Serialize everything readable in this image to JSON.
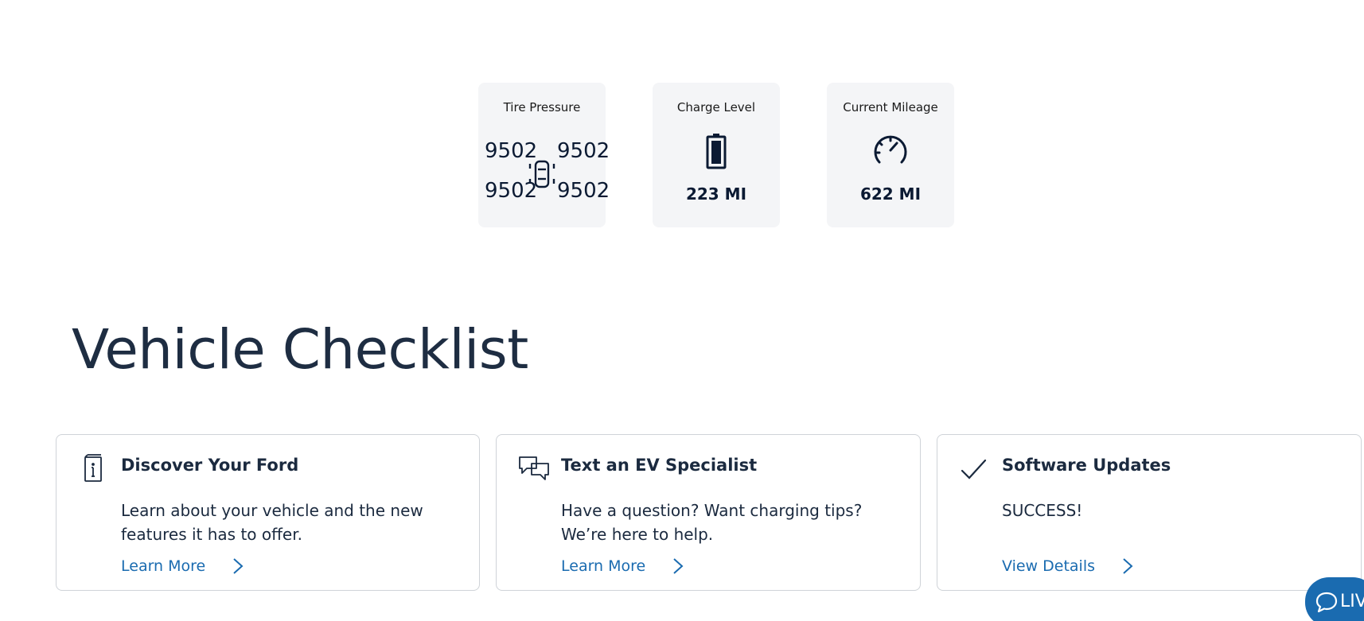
{
  "status_tiles": {
    "tire_pressure": {
      "title": "Tire Pressure",
      "front_left": "9502",
      "front_right": "9502",
      "rear_left": "9502",
      "rear_right": "9502",
      "icon": "car-top-view-icon"
    },
    "charge_level": {
      "title": "Charge Level",
      "value": "223 MI",
      "icon": "battery-icon"
    },
    "current_mileage": {
      "title": "Current Mileage",
      "value": "622 MI",
      "icon": "speedometer-icon"
    }
  },
  "checklist": {
    "heading": "Vehicle Checklist",
    "cards": [
      {
        "title": "Discover Your Ford",
        "body": "Learn about your vehicle and the new features it has to offer.",
        "link": "Learn More",
        "icon": "manual-book-icon"
      },
      {
        "title": "Text an EV Specialist",
        "body": "Have a question? Want charging tips? We’re here to help.",
        "link": "Learn More",
        "icon": "chat-bubbles-icon"
      },
      {
        "title": "Software Updates",
        "body": "SUCCESS!",
        "link": "View Details",
        "icon": "checkmark-icon"
      }
    ]
  },
  "live_chat": {
    "label": "LIV",
    "icon": "chat-bubble-icon"
  },
  "colors": {
    "accent": "#1a6bb0",
    "text_dark": "#1b2a3f",
    "tile_background": "#f4f5f7",
    "card_border": "#cfd3d8"
  }
}
